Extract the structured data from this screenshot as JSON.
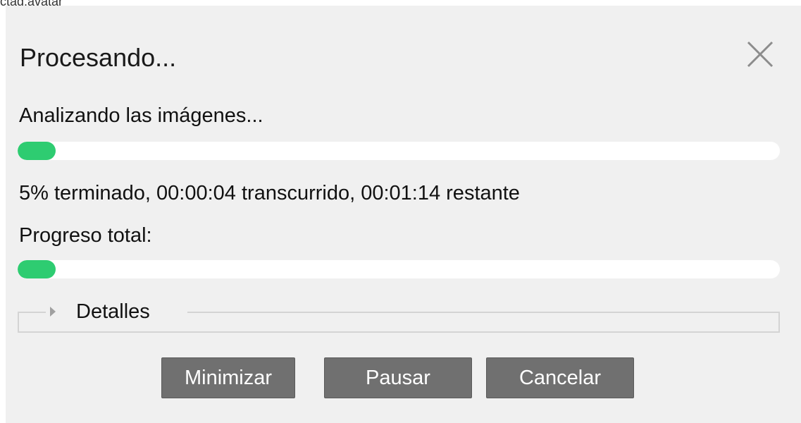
{
  "window": {
    "title": "ctag:avatar"
  },
  "dialog": {
    "title": "Procesando...",
    "close_icon": "close-icon",
    "status_text": "Analizando las imágenes...",
    "current_progress": {
      "percent": 5
    },
    "elapsed_text": "5% terminado, 00:00:04 transcurrido, 00:01:14 restante",
    "total_label": "Progreso total:",
    "total_progress": {
      "percent": 5
    },
    "details": {
      "label": "Detalles",
      "icon": "expand-triangle-icon",
      "expanded": false
    },
    "buttons": {
      "minimize": "Minimizar",
      "pause": "Pausar",
      "cancel": "Cancelar"
    }
  },
  "colors": {
    "background": "#f0f0f0",
    "progress_fill": "#2ecc71",
    "progress_track": "#ffffff",
    "button": "#707070",
    "button_text": "#ffffff"
  }
}
